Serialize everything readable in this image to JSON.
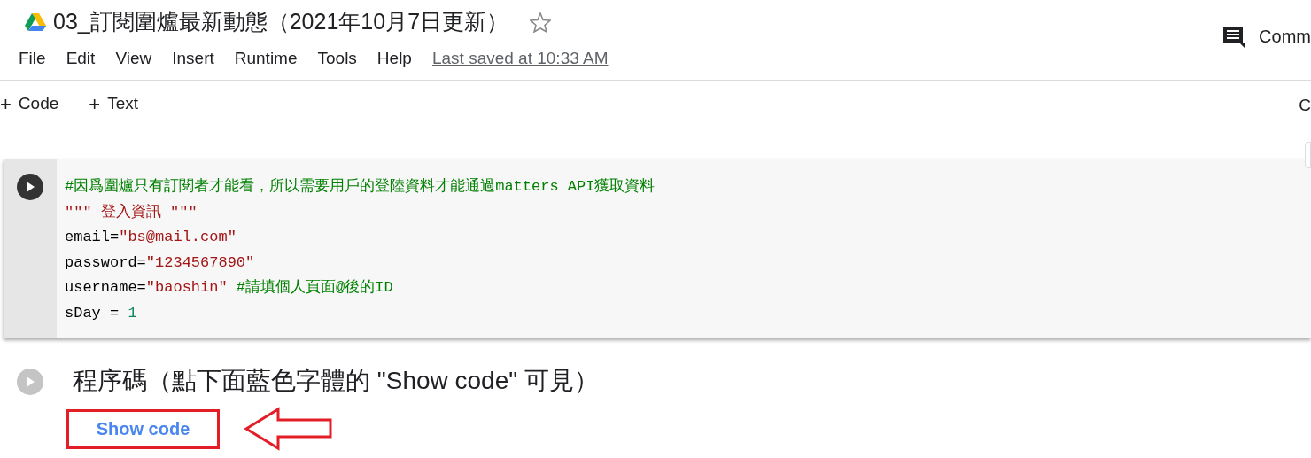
{
  "title": "03_訂閱圍爐最新動態（2021年10月7日更新）",
  "starred": false,
  "menu": [
    "File",
    "Edit",
    "View",
    "Insert",
    "Runtime",
    "Tools",
    "Help"
  ],
  "last_saved": "Last saved at 10:33 AM",
  "comment_button": "Comm",
  "toolbar": [
    {
      "icon": "+",
      "label": "Code"
    },
    {
      "icon": "+",
      "label": "Text"
    }
  ],
  "toolbar_right": "C",
  "code_cell": {
    "lines": [
      [
        {
          "kind": "comment",
          "text": "#因爲圍爐只有訂閱者才能看，所以需要用戶的登陸資料才能通過matters API獲取資料"
        }
      ],
      [
        {
          "kind": "string",
          "text": "\"\"\" 登入資訊 \"\"\""
        }
      ],
      [
        {
          "kind": "plain",
          "text": "email="
        },
        {
          "kind": "string",
          "text": "\"bs@mail.com\""
        }
      ],
      [
        {
          "kind": "plain",
          "text": "password="
        },
        {
          "kind": "string",
          "text": "\"1234567890\""
        }
      ],
      [
        {
          "kind": "plain",
          "text": "username="
        },
        {
          "kind": "string",
          "text": "\"baoshin\""
        },
        {
          "kind": "comment",
          "gap": true,
          "text": "#請填個人頁面@後的ID"
        }
      ],
      [
        {
          "kind": "plain",
          "text": "sDay = "
        },
        {
          "kind": "number",
          "text": "1"
        }
      ]
    ]
  },
  "text_cell": {
    "heading": "程序碼（點下面藍色字體的 \"Show code\" 可見）",
    "link": "Show code"
  }
}
